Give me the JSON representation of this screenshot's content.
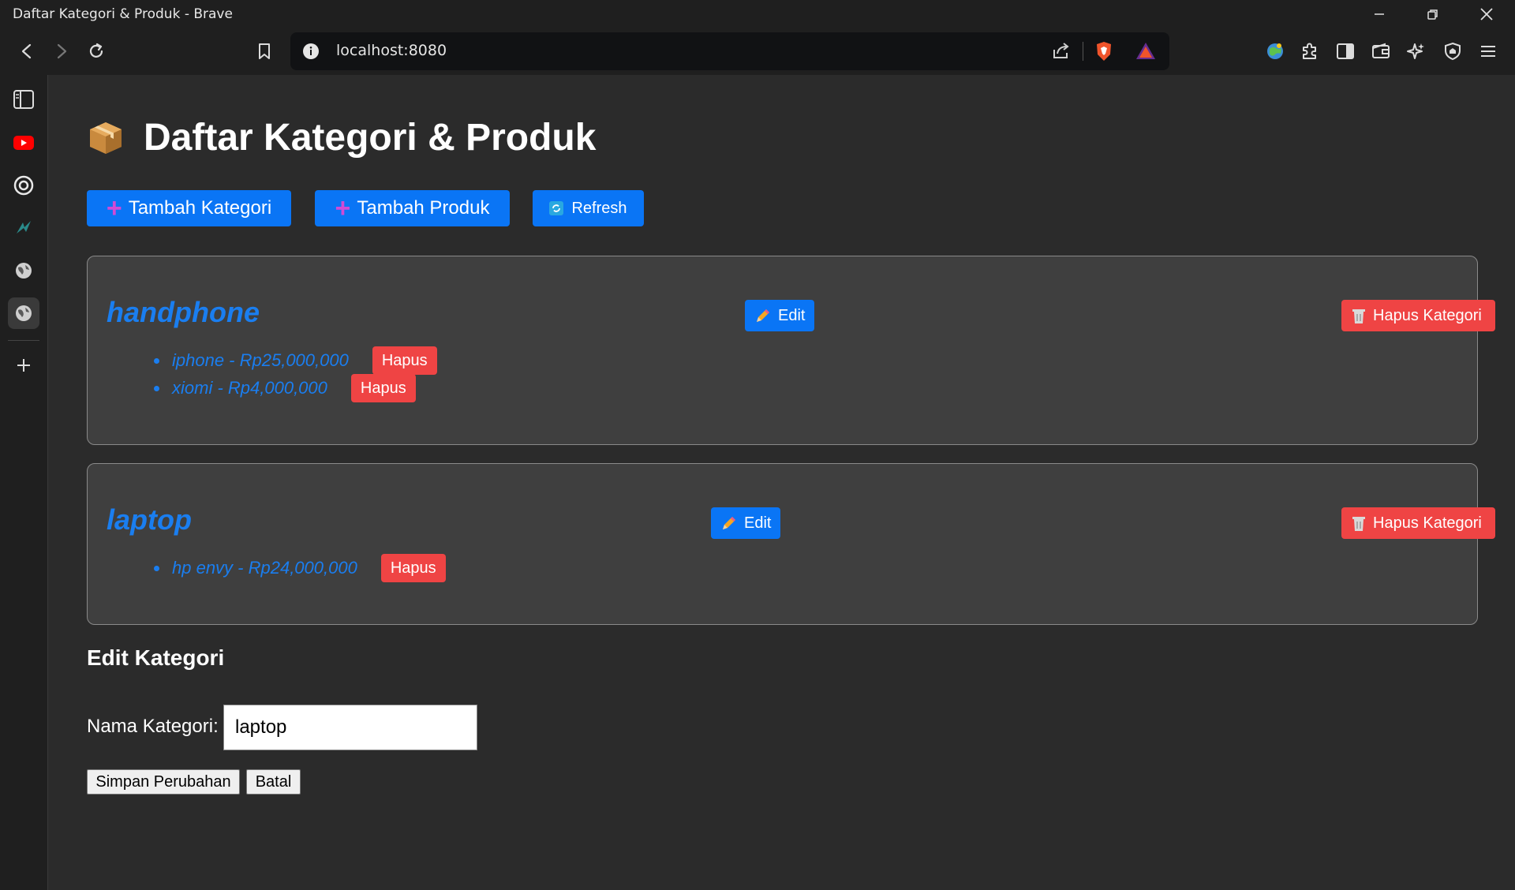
{
  "window": {
    "title": "Daftar Kategori & Produk - Brave"
  },
  "browser": {
    "url": "localhost:8080"
  },
  "page": {
    "title": "Daftar Kategori & Produk",
    "actions": {
      "add_category": "Tambah Kategori",
      "add_product": "Tambah Produk",
      "refresh": "Refresh"
    }
  },
  "categories": [
    {
      "name": "handphone",
      "edit_label": "Edit",
      "delete_label": "Hapus Kategori",
      "products": [
        {
          "text": "iphone - Rp25,000,000",
          "delete_label": "Hapus"
        },
        {
          "text": "xiomi - Rp4,000,000",
          "delete_label": "Hapus"
        }
      ]
    },
    {
      "name": "laptop",
      "edit_label": "Edit",
      "delete_label": "Hapus Kategori",
      "products": [
        {
          "text": "hp envy - Rp24,000,000",
          "delete_label": "Hapus"
        }
      ]
    }
  ],
  "edit_form": {
    "title": "Edit Kategori",
    "label": "Nama Kategori:",
    "value": "laptop",
    "save_label": "Simpan Perubahan",
    "cancel_label": "Batal"
  },
  "colors": {
    "accent_blue": "#0a75f5",
    "link_blue": "#1a7ef0",
    "danger_red": "#ef4444",
    "background": "#2b2b2b",
    "card": "#3f3f3f"
  }
}
